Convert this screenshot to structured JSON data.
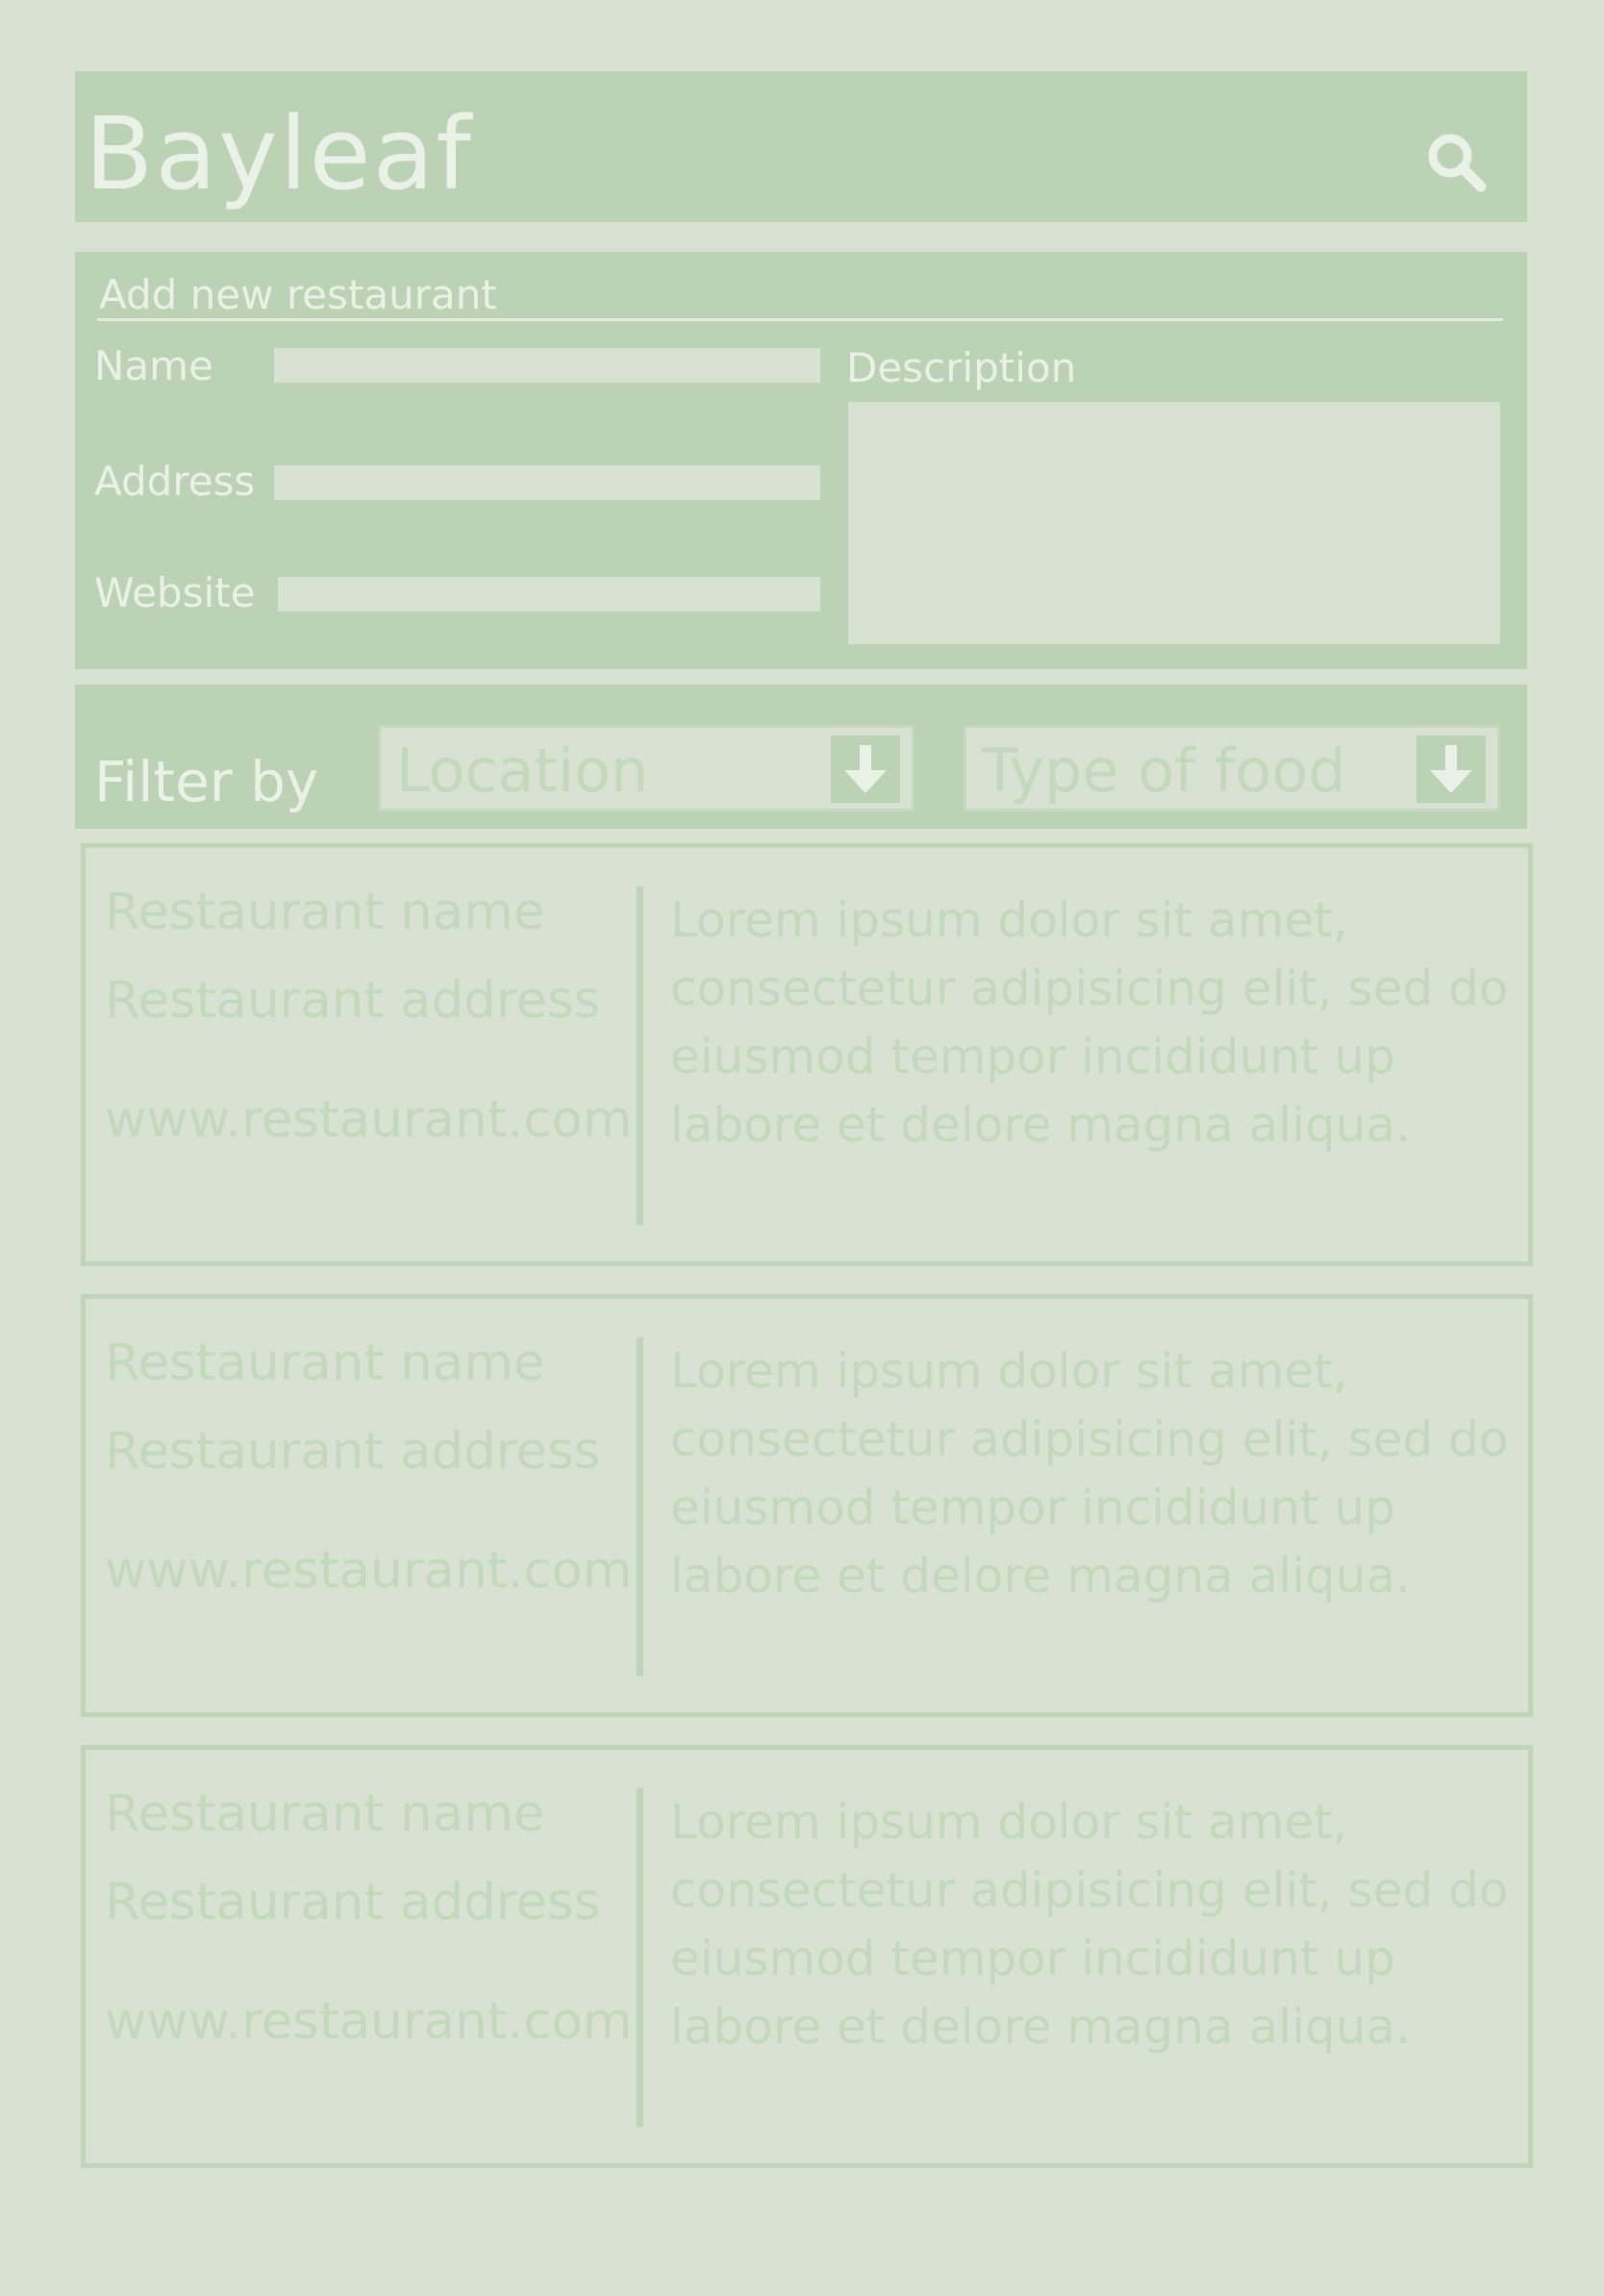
{
  "app": {
    "logo": "Bayleaf"
  },
  "add_form": {
    "title": "Add new restaurant",
    "name_label": "Name",
    "address_label": "Address",
    "website_label": "Website",
    "description_label": "Description",
    "name_value": "",
    "address_value": "",
    "website_value": "",
    "description_value": ""
  },
  "filter": {
    "label": "Filter by",
    "location_placeholder": "Location",
    "food_placeholder": "Type of food"
  },
  "restaurants": [
    {
      "name": "Restaurant name",
      "address": "Restaurant address",
      "website": "www.restaurant.com",
      "description": "Lorem ipsum dolor sit amet, consectetur adipisicing elit, sed do eiusmod tempor incididunt up labore et delore magna aliqua."
    },
    {
      "name": "Restaurant name",
      "address": "Restaurant address",
      "website": "www.restaurant.com",
      "description": "Lorem ipsum dolor sit amet, consectetur adipisicing elit, sed do eiusmod tempor incididunt up labore et delore magna aliqua."
    },
    {
      "name": "Restaurant name",
      "address": "Restaurant address",
      "website": "www.restaurant.com",
      "description": "Lorem ipsum dolor sit amet, consectetur adipisicing elit, sed do eiusmod tempor incididunt up labore et delore magna aliqua."
    }
  ],
  "icons": {
    "search": "search-icon",
    "dropdown": "arrow-down-icon"
  },
  "colors": {
    "background": "#d7e2d2",
    "panel": "#bcd2b5",
    "text_light": "#eaf1e6",
    "text_muted": "#c3d8bc"
  }
}
